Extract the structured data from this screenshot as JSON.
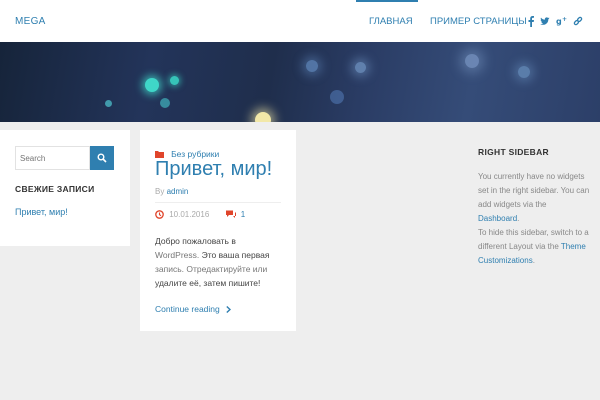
{
  "header": {
    "logo": "MEGA",
    "nav": [
      {
        "label": "ГЛАВНАЯ",
        "active": true
      },
      {
        "label": "ПРИМЕР СТРАНИЦЫ",
        "active": false
      }
    ],
    "social_icons": [
      "facebook-icon",
      "twitter-icon",
      "google-plus-icon",
      "link-icon"
    ],
    "accent_color": "#2f7fb0"
  },
  "left_sidebar": {
    "search_placeholder": "Search",
    "recent_heading": "СВЕЖИЕ ЗАПИСИ",
    "recent_posts": [
      "Привет, мир!"
    ]
  },
  "post": {
    "category": "Без рубрики",
    "title": "Привет, мир!",
    "by_label": "By",
    "author": "admin",
    "date": "10.01.2016",
    "comments": "1",
    "excerpt_lines": [
      "Добро пожаловать в",
      "WordPress. Это ваша первая",
      "запись. Отредактируйте или",
      "удалите её, затем пишите!"
    ],
    "excerpt_parts": {
      "a": "Добро пожаловать в",
      "b": "WordPress.",
      "c": "Это ваша первая",
      "d": "запись. Отредактируйте или",
      "e": "удалите её, затем пишите!"
    },
    "continue_label": "Continue reading"
  },
  "right_sidebar": {
    "heading": "RIGHT SIDEBAR",
    "text1": "You currently have no widgets set in the right sidebar. You can add widgets via the",
    "link1": "Dashboard",
    "text2": "To hide this sidebar, switch to a different Layout via the",
    "link2": "Theme Customizations"
  }
}
